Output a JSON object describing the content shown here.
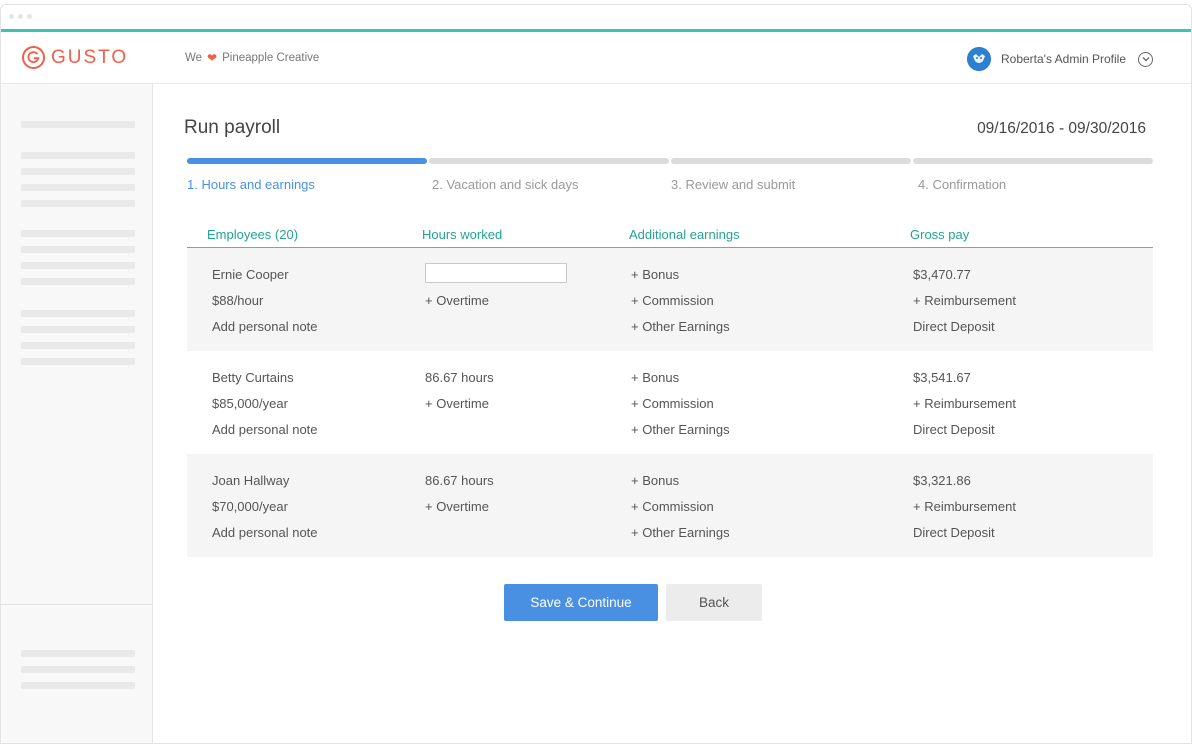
{
  "brand": {
    "name": "GUSTO",
    "color": "#f45d48",
    "accent": "#3dc2b6"
  },
  "header": {
    "company_prefix": "We",
    "heart_icon": "heart-icon",
    "company": "Pineapple Creative",
    "profile": "Roberta's Admin Profile"
  },
  "page": {
    "title": "Run payroll",
    "date_range": "09/16/2016 - 09/30/2016"
  },
  "steps": [
    {
      "label": "1. Hours and earnings",
      "active": true
    },
    {
      "label": "2. Vacation and sick days",
      "active": false
    },
    {
      "label": "3. Review and submit",
      "active": false
    },
    {
      "label": "4. Confirmation",
      "active": false
    }
  ],
  "table": {
    "headers": {
      "employees": "Employees (20)",
      "hours": "Hours worked",
      "additional": "Additional earnings",
      "gross": "Gross pay"
    },
    "rows": [
      {
        "name": "Ernie Cooper",
        "rate": "$88/hour",
        "note": "Add personal note",
        "hours": "",
        "overtime": "+ Overtime",
        "bonus": "+ Bonus",
        "commission": "+ Commission",
        "other": "+ Other Earnings",
        "gross": "$3,470.77",
        "reimbursement": "+ Reimbursement",
        "deposit": "Direct Deposit"
      },
      {
        "name": "Betty Curtains",
        "rate": "$85,000/year",
        "note": "Add personal note",
        "hours": "86.67 hours",
        "overtime": "+ Overtime",
        "bonus": "+ Bonus",
        "commission": "+ Commission",
        "other": "+ Other Earnings",
        "gross": "$3,541.67",
        "reimbursement": "+ Reimbursement",
        "deposit": "Direct Deposit"
      },
      {
        "name": "Joan Hallway",
        "rate": "$70,000/year",
        "note": "Add personal note",
        "hours": "86.67 hours",
        "overtime": "+ Overtime",
        "bonus": "+ Bonus",
        "commission": "+ Commission",
        "other": "+ Other Earnings",
        "gross": "$3,321.86",
        "reimbursement": "+ Reimbursement",
        "deposit": "Direct Deposit"
      }
    ]
  },
  "actions": {
    "save": "Save & Continue",
    "back": "Back"
  }
}
